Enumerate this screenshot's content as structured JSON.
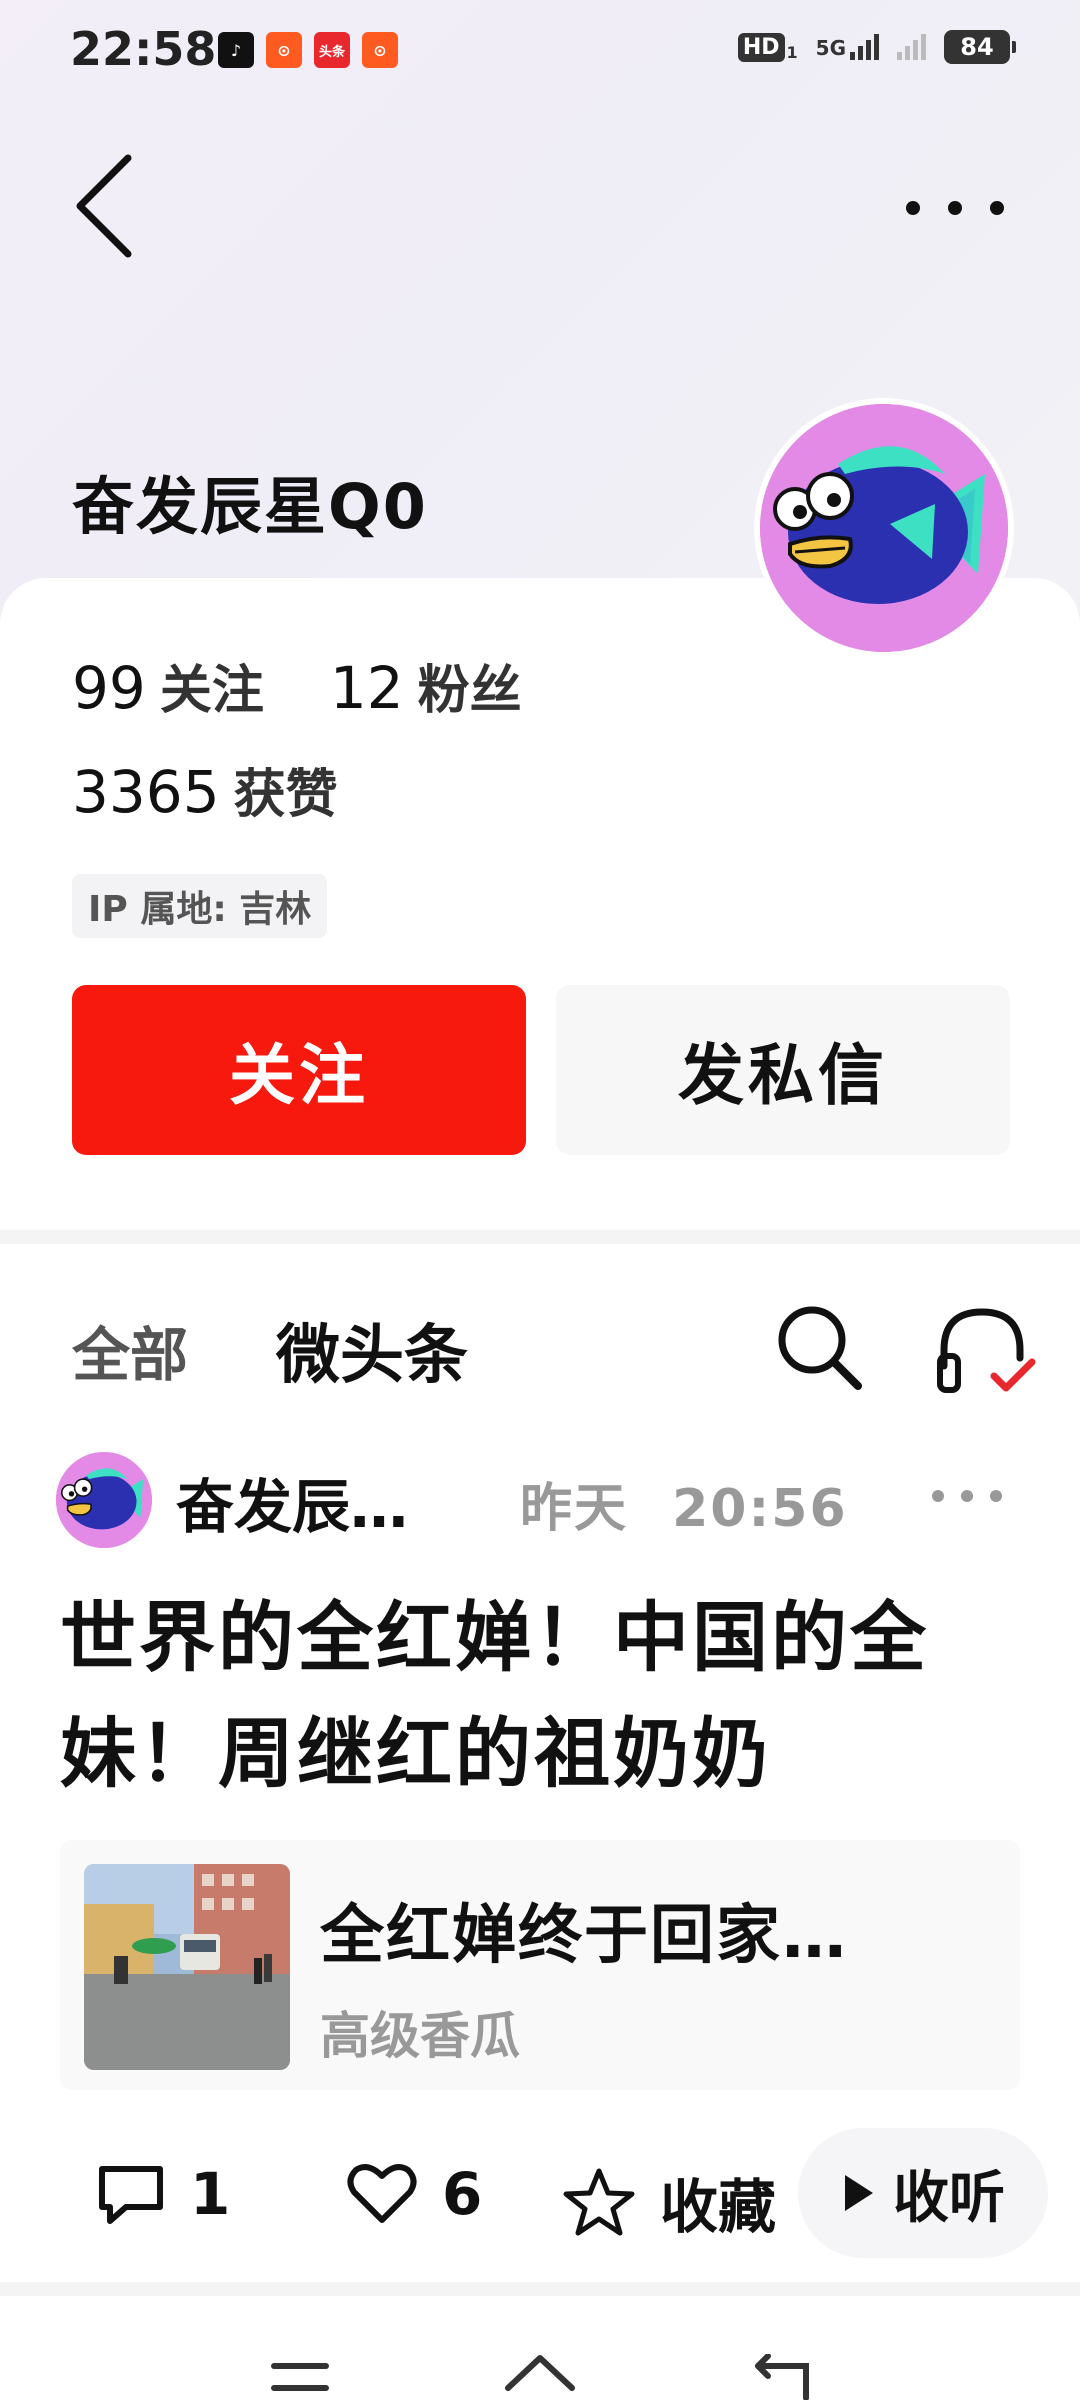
{
  "status_bar": {
    "time": "22:58",
    "app_badges": [
      "douyin",
      "kuaishou",
      "toutiao",
      "kuaishou"
    ],
    "toutiao_label": "头条",
    "hd": "HD",
    "sim_index": "1",
    "network": "5G",
    "battery": "84"
  },
  "profile": {
    "name": "奋发辰星Q0",
    "following_count": "99",
    "following_label": "关注",
    "followers_count": "12",
    "followers_label": "粉丝",
    "likes_count": "3365",
    "likes_label": "获赞",
    "ip_location": "IP 属地: 吉林"
  },
  "buttons": {
    "follow": "关注",
    "message": "发私信"
  },
  "tabs": {
    "all": "全部",
    "micro": "微头条"
  },
  "post": {
    "author": "奋发辰…",
    "date": "昨天",
    "time": "20:56",
    "title_line1": "世界的全红婵！中国的全",
    "title_line2": "妹！周继红的祖奶奶",
    "link_title": "全红婵终于回家…",
    "link_source": "高级香瓜",
    "comments": "1",
    "likes": "6",
    "favorite_label": "收藏",
    "listen_label": "收听"
  },
  "colors": {
    "accent": "#f8190e",
    "avatar_bg": "#e38ae6"
  }
}
